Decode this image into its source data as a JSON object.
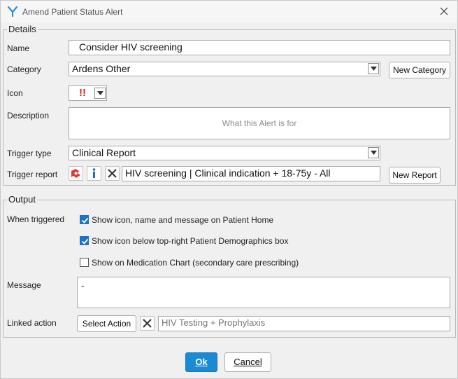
{
  "window": {
    "title": "Amend Patient Status Alert"
  },
  "details": {
    "legend": "Details",
    "name_label": "Name",
    "name_value": "Consider HIV screening",
    "category_label": "Category",
    "category_value": "Ardens Other",
    "new_category_label": "New Category",
    "icon_label": "Icon",
    "icon_glyph": "!!",
    "icon_color": "#e0202a",
    "description_label": "Description",
    "description_placeholder": "What this Alert is for",
    "trigger_type_label": "Trigger type",
    "trigger_type_value": "Clinical Report",
    "trigger_report_label": "Trigger report",
    "trigger_report_value": "HIV screening | Clinical indication + 18-75y  - All",
    "new_report_label": "New Report",
    "report_icons": [
      "report-tool-icon",
      "info-icon",
      "clear-icon"
    ]
  },
  "output": {
    "legend": "Output",
    "when_triggered_label": "When triggered",
    "options": [
      {
        "label": "Show icon, name and message on Patient Home",
        "checked": true
      },
      {
        "label": "Show icon below top-right Patient Demographics box",
        "checked": true
      },
      {
        "label": "Show on Medication Chart (secondary care prescribing)",
        "checked": false
      }
    ],
    "message_label": "Message",
    "message_value": "-",
    "linked_action_label": "Linked action",
    "select_action_label": "Select Action",
    "linked_action_value": "HIV Testing + Prophylaxis"
  },
  "footer": {
    "ok_label": "Ok",
    "cancel_label": "Cancel"
  },
  "colors": {
    "accent": "#1a8ad4",
    "checkbox": "#1a73c8",
    "alert_icon": "#e0202a"
  }
}
